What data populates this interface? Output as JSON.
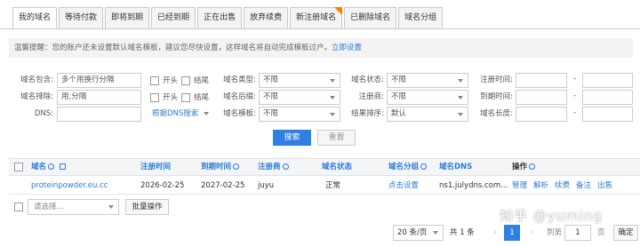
{
  "tabs": [
    {
      "label": "我的域名",
      "active": true
    },
    {
      "label": "等待付款"
    },
    {
      "label": "即将到期"
    },
    {
      "label": "已经到期"
    },
    {
      "label": "正在出售"
    },
    {
      "label": "放弃续费"
    },
    {
      "label": "新注册域名",
      "badge": true
    },
    {
      "label": "已删除域名"
    },
    {
      "label": "域名分组"
    }
  ],
  "notice": {
    "text": "温馨提醒：您的账户还未设置默认域名模板，建议您尽快设置，这样域名将自动完成模板过户。",
    "link": "立即设置"
  },
  "filters": {
    "contains_label": "域名包含:",
    "contains_placeholder": "多个用换行分隔",
    "exclude_label": "域名排除:",
    "exclude_placeholder": "用,分隔",
    "dns_label": "DNS:",
    "prefix_label": "开头",
    "suffix_label": "结尾",
    "type_label": "域名类型:",
    "type_value": "不限",
    "suffix_type_label": "域名后缀:",
    "suffix_type_value": "不限",
    "template_label": "域名模板:",
    "template_value": "不限",
    "dns_search": "根据DNS搜索",
    "status_label": "域名状态:",
    "status_value": "不限",
    "registrar_label": "注册商:",
    "registrar_value": "不限",
    "sort_label": "结果排序:",
    "sort_value": "默认",
    "reg_time_label": "注册时间:",
    "exp_time_label": "到期时间:",
    "length_label": "域名长度:",
    "range_dash": "-"
  },
  "buttons": {
    "search": "搜索",
    "reset": "重置"
  },
  "table": {
    "headers": {
      "domain": "域名",
      "reg_time": "注册时间",
      "exp_time": "到期时间",
      "registrar": "注册商",
      "status": "域名状态",
      "group": "域名分组",
      "dns": "域名DNS",
      "ops": "操作"
    },
    "rows": [
      {
        "domain": "proteinpowder.eu.cc",
        "reg_time": "2026-02-25",
        "exp_time": "2027-02-25",
        "registrar": "juyu",
        "status": "正常",
        "group": "点击设置",
        "dns": "ns1.julydns.com...",
        "ops": [
          "管理",
          "解析",
          "续费",
          "备注",
          "出售"
        ]
      }
    ]
  },
  "bulk": {
    "select_placeholder": "请选择...",
    "action": "批量操作"
  },
  "pagination": {
    "page_size": "20 条/页",
    "total": "共 1 条",
    "prev": "‹",
    "current": "1",
    "next": "›",
    "goto_label": "到第",
    "goto_value": "1",
    "page_suffix": "页",
    "ok": "确定"
  },
  "watermark": "知乎 @yuming",
  "colors": {
    "accent": "#2f7fe4",
    "link": "#2a7bd6",
    "badge": "#ff7a00"
  }
}
